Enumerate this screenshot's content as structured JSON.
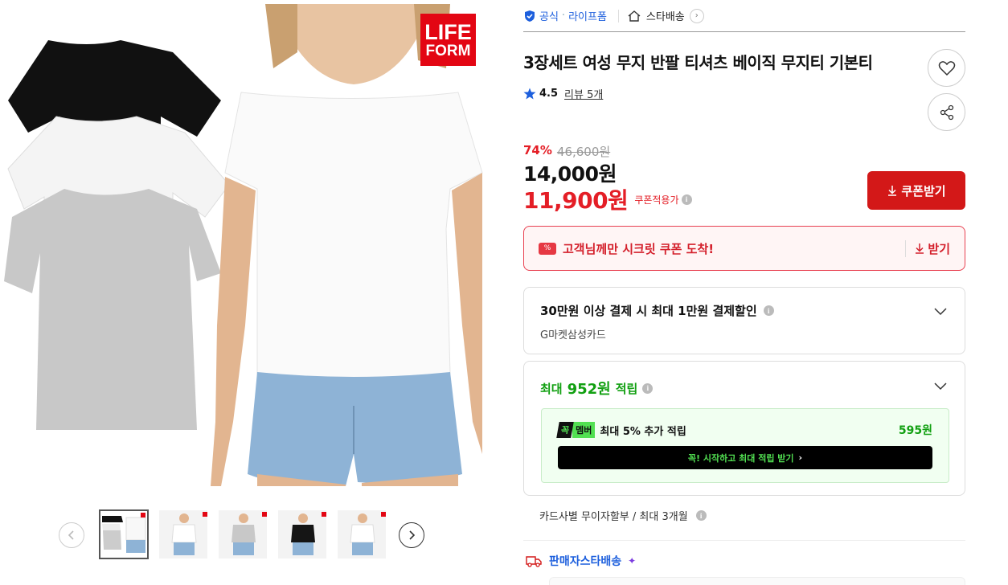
{
  "brand_badge": {
    "line1": "LIFE",
    "line2": "FORM"
  },
  "thumbnails": [
    {
      "name": "thumbnail-1",
      "active": true
    },
    {
      "name": "thumbnail-2",
      "active": false
    },
    {
      "name": "thumbnail-3",
      "active": false
    },
    {
      "name": "thumbnail-4",
      "active": false
    },
    {
      "name": "thumbnail-5",
      "active": false
    }
  ],
  "header": {
    "official_label": "공식",
    "store_name": "라이프폼",
    "delivery_label": "스타배송"
  },
  "product": {
    "title": "3장세트 여성 무지 반팔 티셔츠 베이직 무지티 기본티",
    "rating": "4.5",
    "review_label": "리뷰 5개"
  },
  "price": {
    "discount_rate": "74%",
    "original": "46,600원",
    "sale": "14,000원",
    "coupon_price": "11,900원",
    "coupon_label": "쿠폰적용가",
    "coupon_button": "쿠폰받기"
  },
  "secret_coupon": {
    "icon_text": "%",
    "text": "고객님께만 시크릿 쿠폰 도착!",
    "action": "받기"
  },
  "card_discount": {
    "title": "30만원 이상 결제 시 최대 1만원 결제할인",
    "subtitle": "G마켓삼성카드"
  },
  "points": {
    "prefix": "최대",
    "amount": "952원",
    "suffix": "적립",
    "member_badge_a": "꼭",
    "member_badge_b": "멤버",
    "member_text": "최대 5% 추가 적립",
    "member_points": "595원",
    "member_cta": "꼭! 시작하고 최대 적립 받기"
  },
  "installment": "카드사별 무이자할부 / 최대 3개월",
  "seller_delivery": "판매자스타배송",
  "colors": {
    "accent_red": "#d31818",
    "official_blue": "#1d5fdd",
    "point_green": "#12a012",
    "member_green": "#52e052"
  }
}
